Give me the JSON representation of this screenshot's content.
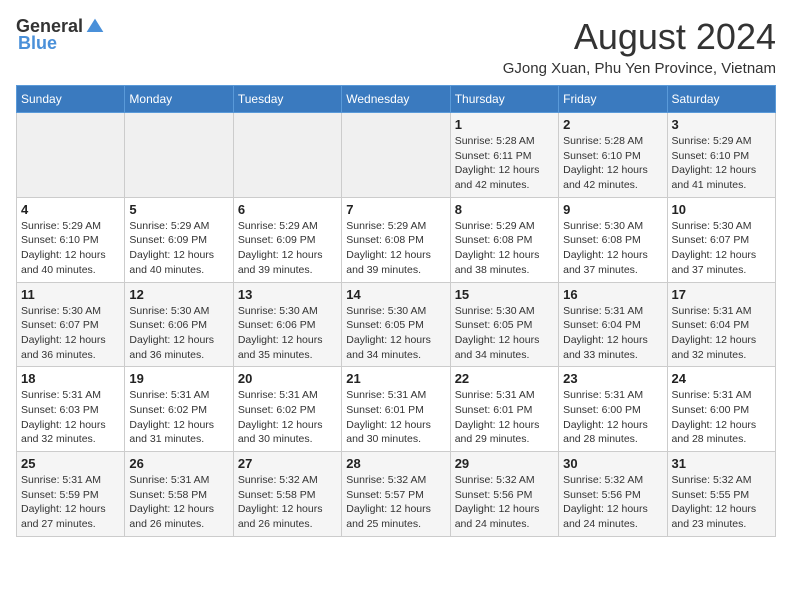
{
  "header": {
    "logo_general": "General",
    "logo_blue": "Blue",
    "month_year": "August 2024",
    "location": "GJong Xuan, Phu Yen Province, Vietnam"
  },
  "days_of_week": [
    "Sunday",
    "Monday",
    "Tuesday",
    "Wednesday",
    "Thursday",
    "Friday",
    "Saturday"
  ],
  "weeks": [
    [
      {
        "num": "",
        "info": ""
      },
      {
        "num": "",
        "info": ""
      },
      {
        "num": "",
        "info": ""
      },
      {
        "num": "",
        "info": ""
      },
      {
        "num": "1",
        "info": "Sunrise: 5:28 AM\nSunset: 6:11 PM\nDaylight: 12 hours\nand 42 minutes."
      },
      {
        "num": "2",
        "info": "Sunrise: 5:28 AM\nSunset: 6:10 PM\nDaylight: 12 hours\nand 42 minutes."
      },
      {
        "num": "3",
        "info": "Sunrise: 5:29 AM\nSunset: 6:10 PM\nDaylight: 12 hours\nand 41 minutes."
      }
    ],
    [
      {
        "num": "4",
        "info": "Sunrise: 5:29 AM\nSunset: 6:10 PM\nDaylight: 12 hours\nand 40 minutes."
      },
      {
        "num": "5",
        "info": "Sunrise: 5:29 AM\nSunset: 6:09 PM\nDaylight: 12 hours\nand 40 minutes."
      },
      {
        "num": "6",
        "info": "Sunrise: 5:29 AM\nSunset: 6:09 PM\nDaylight: 12 hours\nand 39 minutes."
      },
      {
        "num": "7",
        "info": "Sunrise: 5:29 AM\nSunset: 6:08 PM\nDaylight: 12 hours\nand 39 minutes."
      },
      {
        "num": "8",
        "info": "Sunrise: 5:29 AM\nSunset: 6:08 PM\nDaylight: 12 hours\nand 38 minutes."
      },
      {
        "num": "9",
        "info": "Sunrise: 5:30 AM\nSunset: 6:08 PM\nDaylight: 12 hours\nand 37 minutes."
      },
      {
        "num": "10",
        "info": "Sunrise: 5:30 AM\nSunset: 6:07 PM\nDaylight: 12 hours\nand 37 minutes."
      }
    ],
    [
      {
        "num": "11",
        "info": "Sunrise: 5:30 AM\nSunset: 6:07 PM\nDaylight: 12 hours\nand 36 minutes."
      },
      {
        "num": "12",
        "info": "Sunrise: 5:30 AM\nSunset: 6:06 PM\nDaylight: 12 hours\nand 36 minutes."
      },
      {
        "num": "13",
        "info": "Sunrise: 5:30 AM\nSunset: 6:06 PM\nDaylight: 12 hours\nand 35 minutes."
      },
      {
        "num": "14",
        "info": "Sunrise: 5:30 AM\nSunset: 6:05 PM\nDaylight: 12 hours\nand 34 minutes."
      },
      {
        "num": "15",
        "info": "Sunrise: 5:30 AM\nSunset: 6:05 PM\nDaylight: 12 hours\nand 34 minutes."
      },
      {
        "num": "16",
        "info": "Sunrise: 5:31 AM\nSunset: 6:04 PM\nDaylight: 12 hours\nand 33 minutes."
      },
      {
        "num": "17",
        "info": "Sunrise: 5:31 AM\nSunset: 6:04 PM\nDaylight: 12 hours\nand 32 minutes."
      }
    ],
    [
      {
        "num": "18",
        "info": "Sunrise: 5:31 AM\nSunset: 6:03 PM\nDaylight: 12 hours\nand 32 minutes."
      },
      {
        "num": "19",
        "info": "Sunrise: 5:31 AM\nSunset: 6:02 PM\nDaylight: 12 hours\nand 31 minutes."
      },
      {
        "num": "20",
        "info": "Sunrise: 5:31 AM\nSunset: 6:02 PM\nDaylight: 12 hours\nand 30 minutes."
      },
      {
        "num": "21",
        "info": "Sunrise: 5:31 AM\nSunset: 6:01 PM\nDaylight: 12 hours\nand 30 minutes."
      },
      {
        "num": "22",
        "info": "Sunrise: 5:31 AM\nSunset: 6:01 PM\nDaylight: 12 hours\nand 29 minutes."
      },
      {
        "num": "23",
        "info": "Sunrise: 5:31 AM\nSunset: 6:00 PM\nDaylight: 12 hours\nand 28 minutes."
      },
      {
        "num": "24",
        "info": "Sunrise: 5:31 AM\nSunset: 6:00 PM\nDaylight: 12 hours\nand 28 minutes."
      }
    ],
    [
      {
        "num": "25",
        "info": "Sunrise: 5:31 AM\nSunset: 5:59 PM\nDaylight: 12 hours\nand 27 minutes."
      },
      {
        "num": "26",
        "info": "Sunrise: 5:31 AM\nSunset: 5:58 PM\nDaylight: 12 hours\nand 26 minutes."
      },
      {
        "num": "27",
        "info": "Sunrise: 5:32 AM\nSunset: 5:58 PM\nDaylight: 12 hours\nand 26 minutes."
      },
      {
        "num": "28",
        "info": "Sunrise: 5:32 AM\nSunset: 5:57 PM\nDaylight: 12 hours\nand 25 minutes."
      },
      {
        "num": "29",
        "info": "Sunrise: 5:32 AM\nSunset: 5:56 PM\nDaylight: 12 hours\nand 24 minutes."
      },
      {
        "num": "30",
        "info": "Sunrise: 5:32 AM\nSunset: 5:56 PM\nDaylight: 12 hours\nand 24 minutes."
      },
      {
        "num": "31",
        "info": "Sunrise: 5:32 AM\nSunset: 5:55 PM\nDaylight: 12 hours\nand 23 minutes."
      }
    ]
  ]
}
